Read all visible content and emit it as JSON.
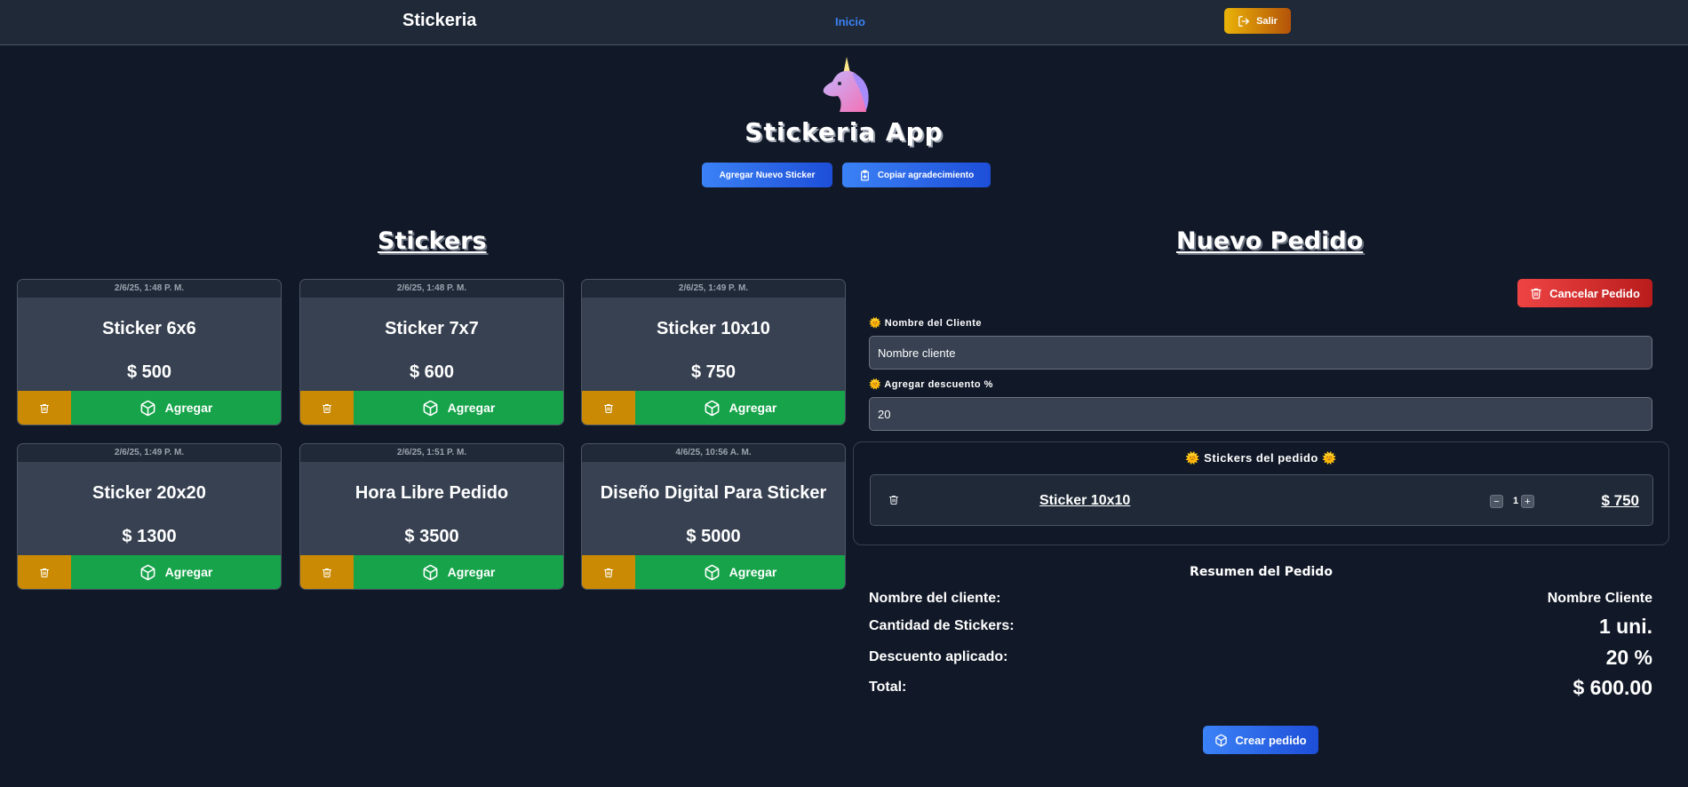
{
  "header": {
    "brand": "Stickeria",
    "nav_home": "Inicio",
    "logout_label": "Salir"
  },
  "hero": {
    "title": "Stickeria App",
    "add_sticker_label": "Agregar Nuevo Sticker",
    "copy_thanks_label": "Copiar agradecimiento"
  },
  "stickers_section": {
    "title": "Stickers",
    "add_label": "Agregar",
    "items": [
      {
        "date": "2/6/25, 1:48 P. M.",
        "name": "Sticker 6x6",
        "price": "$ 500"
      },
      {
        "date": "2/6/25, 1:48 P. M.",
        "name": "Sticker 7x7",
        "price": "$ 600"
      },
      {
        "date": "2/6/25, 1:49 P. M.",
        "name": "Sticker 10x10",
        "price": "$ 750"
      },
      {
        "date": "2/6/25, 1:49 P. M.",
        "name": "Sticker 20x20",
        "price": "$ 1300"
      },
      {
        "date": "2/6/25, 1:51 P. M.",
        "name": "Hora Libre Pedido",
        "price": "$ 3500"
      },
      {
        "date": "4/6/25, 10:56 A. M.",
        "name": "Diseño Digital Para Sticker",
        "price": "$ 5000"
      }
    ]
  },
  "order": {
    "title": "Nuevo Pedido",
    "cancel_label": "Cancelar Pedido",
    "client_label": "🌞 Nombre del Cliente",
    "client_value": "Nombre cliente",
    "discount_label": "🌞 Agregar descuento %",
    "discount_value": "20",
    "items_title": "🌞 Stickers del pedido 🌞",
    "items": [
      {
        "name": "Sticker 10x10",
        "qty": "1",
        "price": "$ 750"
      }
    ],
    "qty_minus": "−",
    "qty_plus": "+",
    "summary": {
      "title": "Resumen del Pedido",
      "client_label": "Nombre del cliente:",
      "client_value": "Nombre Cliente",
      "count_label": "Cantidad de Stickers:",
      "count_value": "1 uni.",
      "discount_label": "Descuento aplicado:",
      "discount_value": "20 %",
      "total_label": "Total:",
      "total_value": "$ 600.00"
    },
    "create_label": "Crear pedido"
  },
  "colors": {
    "background": "#111827",
    "card": "#374151",
    "accent_blue": "#3b82f6",
    "delete_orange": "#ca8a04",
    "add_green": "#16a34a",
    "cancel_red": "#ef4444"
  }
}
